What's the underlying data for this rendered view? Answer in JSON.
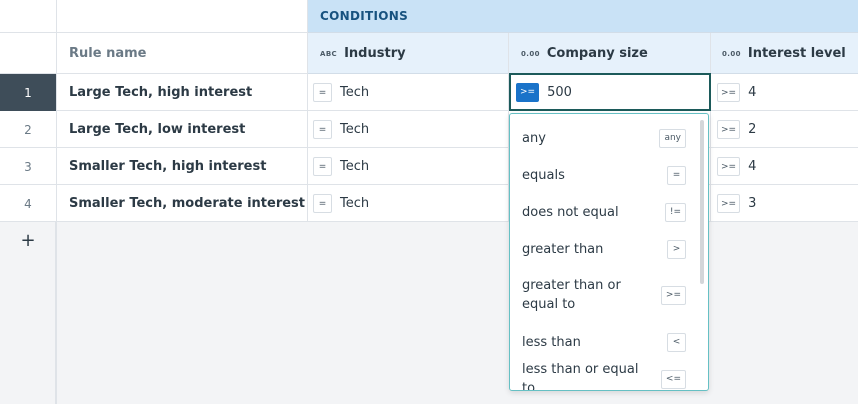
{
  "header": {
    "group_label": "CONDITIONS"
  },
  "columns": {
    "rule_name": "Rule name",
    "industry": {
      "type_tag": "ABC",
      "label": "Industry"
    },
    "company_size": {
      "type_tag": "0.00",
      "label": "Company size"
    },
    "interest_level": {
      "type_tag": "0.00",
      "label": "Interest level"
    }
  },
  "rows": [
    {
      "num": "1",
      "name": "Large Tech, high interest",
      "industry_op": "=",
      "industry": "Tech",
      "size_op": ">=",
      "size": "500",
      "interest_op": ">=",
      "interest": "4"
    },
    {
      "num": "2",
      "name": "Large Tech, low interest",
      "industry_op": "=",
      "industry": "Tech",
      "interest_op": ">=",
      "interest": "2"
    },
    {
      "num": "3",
      "name": "Smaller Tech, high interest",
      "industry_op": "=",
      "industry": "Tech",
      "interest_op": ">=",
      "interest": "4"
    },
    {
      "num": "4",
      "name": "Smaller Tech, moderate interest",
      "industry_op": "=",
      "industry": "Tech",
      "interest_op": ">=",
      "interest": "3"
    }
  ],
  "add_row": "+",
  "dropdown": {
    "items": [
      {
        "label": "any",
        "op": "any"
      },
      {
        "label": "equals",
        "op": "="
      },
      {
        "label": "does not equal",
        "op": "!="
      },
      {
        "label": "greater than",
        "op": ">"
      },
      {
        "label": "greater than or equal to",
        "op": ">="
      },
      {
        "label": "less than",
        "op": "<"
      },
      {
        "label": "less than or equal to",
        "op": "<="
      }
    ]
  },
  "colors": {
    "accent": "#1a73c9",
    "conditions_band": "#c9e2f6",
    "active_row": "#3e4d59",
    "dropdown_border": "#66c0c4"
  }
}
